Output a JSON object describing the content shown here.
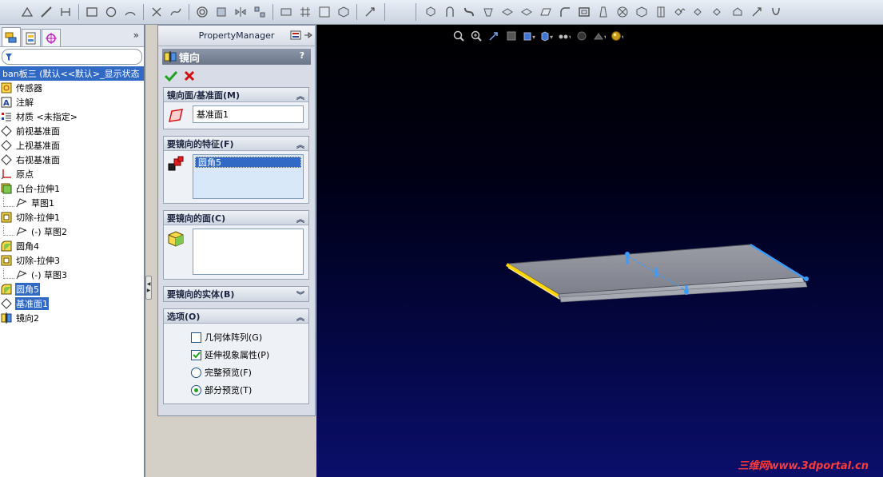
{
  "tree": {
    "root_label": "ban板三  (默认<<默认>_显示状态",
    "items": [
      {
        "label": "传感器",
        "icon": "sensor-icon",
        "indent": 0,
        "highlight": false
      },
      {
        "label": "注解",
        "icon": "annotation-icon",
        "indent": 0,
        "highlight": false
      },
      {
        "label": "材质 <未指定>",
        "icon": "material-icon",
        "indent": 0,
        "highlight": false
      },
      {
        "label": "前视基准面",
        "icon": "plane-icon",
        "indent": 0,
        "highlight": false
      },
      {
        "label": "上视基准面",
        "icon": "plane-icon",
        "indent": 0,
        "highlight": false
      },
      {
        "label": "右视基准面",
        "icon": "plane-icon",
        "indent": 0,
        "highlight": false
      },
      {
        "label": "原点",
        "icon": "origin-icon",
        "indent": 0,
        "highlight": false
      },
      {
        "label": "凸台-拉伸1",
        "icon": "extrude-icon",
        "indent": 0,
        "highlight": false
      },
      {
        "label": "草图1",
        "icon": "sketch-icon",
        "indent": 1,
        "highlight": false
      },
      {
        "label": "切除-拉伸1",
        "icon": "cut-icon",
        "indent": 0,
        "highlight": false
      },
      {
        "label": "(-) 草图2",
        "icon": "sketch-icon",
        "indent": 1,
        "highlight": false
      },
      {
        "label": "圆角4",
        "icon": "fillet-icon",
        "indent": 0,
        "highlight": false
      },
      {
        "label": "切除-拉伸3",
        "icon": "cut-icon",
        "indent": 0,
        "highlight": false
      },
      {
        "label": "(-) 草图3",
        "icon": "sketch-icon",
        "indent": 1,
        "highlight": false
      },
      {
        "label": "圆角5",
        "icon": "fillet-icon",
        "indent": 0,
        "highlight": true
      },
      {
        "label": "基准面1",
        "icon": "plane-icon",
        "indent": 0,
        "highlight": true
      },
      {
        "label": "镜向2",
        "icon": "mirror-icon",
        "indent": 0,
        "highlight": false
      }
    ]
  },
  "pm": {
    "header": "PropertyManager",
    "title": "镜向",
    "help": "?",
    "groups": {
      "mirror_plane": {
        "label": "镜向面/基准面(M)",
        "value": "基准面1"
      },
      "features": {
        "label": "要镜向的特征(F)",
        "items": [
          "圆角5"
        ]
      },
      "faces": {
        "label": "要镜向的面(C)"
      },
      "bodies": {
        "label": "要镜向的实体(B)"
      },
      "options": {
        "label": "选项(O)",
        "geometry_pattern": "几何体阵列(G)",
        "propagate_visual": "延伸视象属性(P)",
        "full_preview": "完整预览(F)",
        "partial_preview": "部分预览(T)"
      }
    }
  },
  "viewport": {
    "watermark": "三维网www.3dportal.cn"
  },
  "colors": {
    "selection": "#316ac5",
    "edge_highlight": "#ffd400",
    "edge_blue": "#3a9cff",
    "ok_green": "#21a121",
    "cancel_red": "#d01010"
  },
  "options_state": {
    "geometry_pattern": false,
    "propagate_visual": true,
    "preview": "partial"
  }
}
